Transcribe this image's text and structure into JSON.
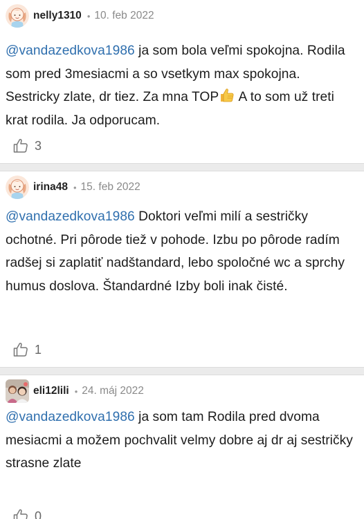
{
  "comments": [
    {
      "author": "nelly1310",
      "date": "10. feb 2022",
      "mention": "@vandazedkova1986",
      "text_before_emoji": " ja som bola veľmi spokojna. Rodila som pred 3mesiacmi a so vsetkym max spokojna. Sestricky zlate, dr tiez. Za mna TOP",
      "emoji": "thumbs-up-emoji",
      "text_after_emoji": " A to som už treti krat rodila. Ja odporucam.",
      "likes": "3"
    },
    {
      "author": "irina48",
      "date": "15. feb 2022",
      "mention": "@vandazedkova1986",
      "text": " Doktori veľmi milí a sestričky ochotné. Pri pôrode tiež v pohode. Izbu po pôrode radím radšej si zaplatiť nadštandard, lebo spoločné wc a sprchy humus doslova. Štandardné Izby boli inak čisté.",
      "likes": "1"
    },
    {
      "author": "eli12lili",
      "date": "24. máj 2022",
      "mention": "@vandazedkova1986",
      "text": " ja som tam Rodila pred dvoma mesiacmi a možem pochvalit velmy dobre aj dr aj sestričky strasne zlate",
      "likes": "0"
    }
  ],
  "separator": "•",
  "colors": {
    "mention": "#2f6fae",
    "divider": "#ebebeb",
    "meta": "#8a8a8a"
  },
  "icons": {
    "like": "thumbs-up-outline-icon",
    "avatar_default": "girl-avatar-icon"
  }
}
